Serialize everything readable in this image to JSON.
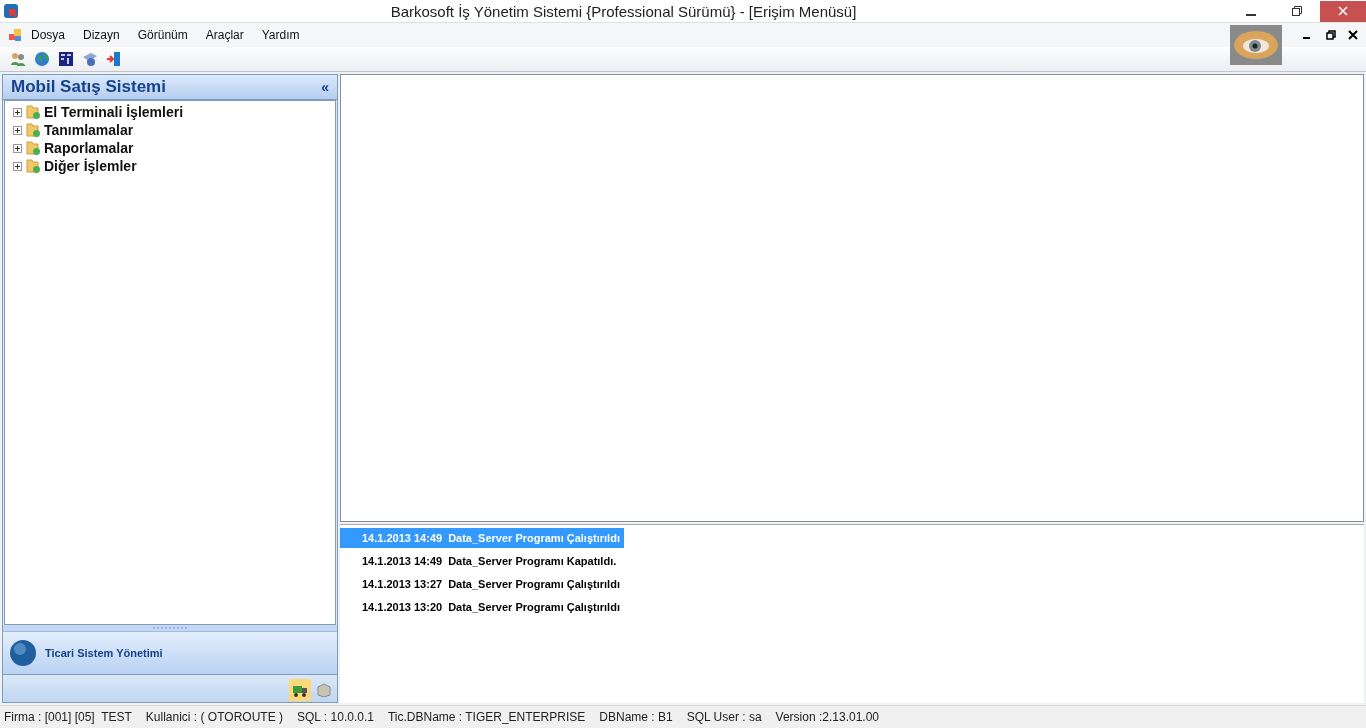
{
  "window": {
    "title": "Barkosoft İş Yönetim Sistemi {Professional Sürümü} - [Erişim Menüsü]"
  },
  "menu": [
    "Dosya",
    "Dizayn",
    "Görünüm",
    "Araçlar",
    "Yardım"
  ],
  "sidebar": {
    "title": "Mobil Satış Sistemi",
    "collapse": "«",
    "tree": [
      {
        "label": "El Terminali İşlemleri",
        "expanded": false
      },
      {
        "label": "Tanımlamalar",
        "expanded": false
      },
      {
        "label": "Raporlamalar",
        "expanded": false
      },
      {
        "label": "Diğer İşlemler",
        "expanded": false
      }
    ],
    "nav_button": "Ticari Sistem Yönetimi",
    "bottom_icons": [
      {
        "kind": "truck",
        "selected": true
      },
      {
        "kind": "box",
        "selected": false
      }
    ]
  },
  "log": [
    {
      "time": "14.1.2013 14:49",
      "message": "Data_Server Programı Çalıştırıldı",
      "selected": true
    },
    {
      "time": "14.1.2013 14:49",
      "message": "Data_Server Programı Kapatıldı.",
      "selected": false
    },
    {
      "time": "14.1.2013 13:27",
      "message": "Data_Server Programı Çalıştırıldı",
      "selected": false
    },
    {
      "time": "14.1.2013 13:20",
      "message": "Data_Server Programı Çalıştırıldı",
      "selected": false
    }
  ],
  "status_bar": [
    "Firma : [001] [05]  TEST",
    "Kullanici : ( OTOROUTE )",
    "SQL : 10.0.0.1",
    "Tic.DBName : TIGER_ENTERPRISE",
    "DBName : B1",
    "SQL User : sa",
    "Version :2.13.01.00"
  ]
}
